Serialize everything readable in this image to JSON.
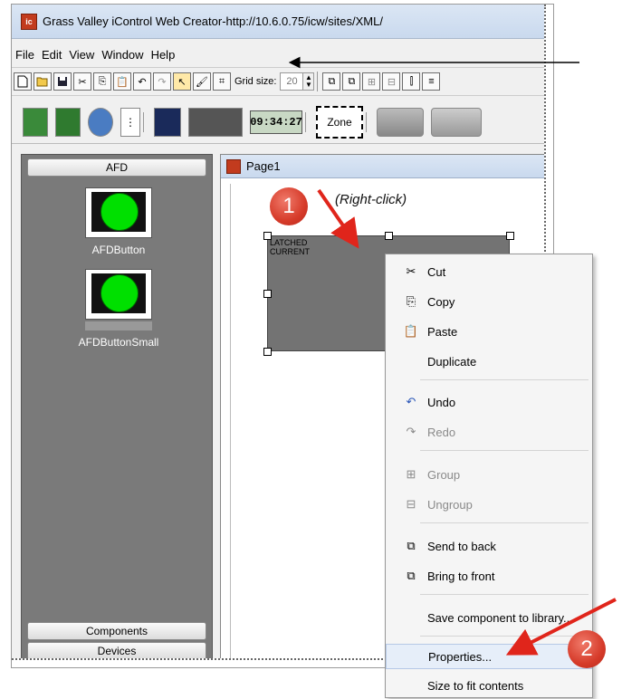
{
  "window": {
    "title": "Grass Valley iControl Web Creator-http://10.6.0.75/icw/sites/XML/",
    "icon": "ic"
  },
  "menubar": {
    "items": [
      "File",
      "Edit",
      "View",
      "Window",
      "Help"
    ]
  },
  "toolbar": {
    "grid_label": "Grid size:",
    "grid_value": "20",
    "icons": [
      "new-file-icon",
      "open-folder-icon",
      "save-icon",
      "cut-icon",
      "copy-icon",
      "paste-icon",
      "undo-icon",
      "redo-icon",
      "pointer-icon",
      "paintbrush-icon",
      "frame-icon"
    ],
    "arrange_icons": [
      "send-to-back-icon",
      "bring-to-front-icon",
      "group-icon",
      "ungroup-icon",
      "align-left-icon",
      "align-icon"
    ]
  },
  "toolbar2": {
    "clock_text": "09:34:27",
    "zone_label": "Zone"
  },
  "left_panel": {
    "header": "AFD",
    "components": [
      {
        "label": "AFDButton"
      },
      {
        "label": "AFDButtonSmall"
      }
    ],
    "footer_buttons": [
      "Components",
      "Devices"
    ]
  },
  "page": {
    "tab_name": "Page1",
    "annotation": "(Right-click)",
    "widget_text_line1": "LATCHED",
    "widget_text_line2": "CURRENT"
  },
  "context_menu": {
    "items": [
      {
        "icon": "cut-icon",
        "label": "Cut",
        "enabled": true
      },
      {
        "icon": "copy-icon",
        "label": "Copy",
        "enabled": true
      },
      {
        "icon": "paste-icon",
        "label": "Paste",
        "enabled": true
      },
      {
        "icon": "",
        "label": "Duplicate",
        "enabled": true
      },
      {
        "icon": "undo-icon",
        "label": "Undo",
        "enabled": true
      },
      {
        "icon": "redo-icon",
        "label": "Redo",
        "enabled": false
      },
      {
        "icon": "group-icon",
        "label": "Group",
        "enabled": false
      },
      {
        "icon": "ungroup-icon",
        "label": "Ungroup",
        "enabled": false
      },
      {
        "icon": "send-to-back-icon",
        "label": "Send to back",
        "enabled": true
      },
      {
        "icon": "bring-to-front-icon",
        "label": "Bring to front",
        "enabled": true
      },
      {
        "icon": "",
        "label": "Save component to library...",
        "enabled": true
      },
      {
        "icon": "",
        "label": "Properties...",
        "enabled": true
      },
      {
        "icon": "",
        "label": "Size to fit contents",
        "enabled": true
      }
    ]
  },
  "callouts": {
    "step1": "1",
    "step2": "2"
  },
  "colors": {
    "callout": "#d63b2a",
    "arrow": "#e0251b",
    "widget": "#737373",
    "panel": "#7a7a7a",
    "afd_ball": "#00e000"
  }
}
